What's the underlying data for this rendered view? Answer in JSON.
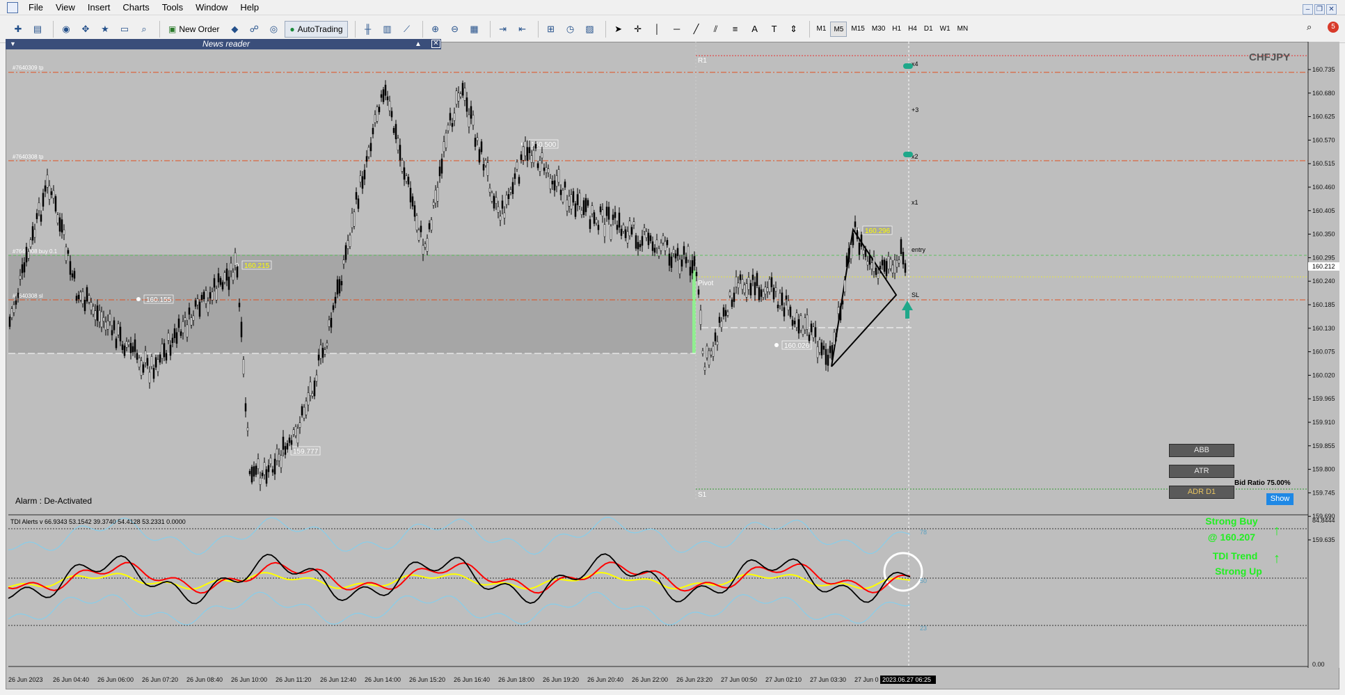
{
  "menu": {
    "items": [
      "File",
      "View",
      "Insert",
      "Charts",
      "Tools",
      "Window",
      "Help"
    ]
  },
  "window_controls": {
    "minimize": "–",
    "restore": "❐",
    "close": "✕"
  },
  "toolbar": {
    "new_order_label": "New Order",
    "autotrading_label": "AutoTrading",
    "timeframes": [
      "M1",
      "M5",
      "M15",
      "M30",
      "H1",
      "H4",
      "D1",
      "W1",
      "MN"
    ],
    "active_timeframe": "M5",
    "notification_count": "5"
  },
  "news_reader": {
    "title": "News reader"
  },
  "chart": {
    "symbol": "CHFJPY",
    "alarm_text": "Alarm : De-Activated",
    "bid_ratio_text": "Bid Ratio 75.00%",
    "show_button": "Show",
    "side_buttons": [
      "ABB",
      "ATR",
      "ADR D1"
    ],
    "price_ticks": [
      "160.735",
      "160.680",
      "160.625",
      "160.570",
      "160.515",
      "160.460",
      "160.405",
      "160.350",
      "160.295",
      "160.240",
      "160.185",
      "160.130",
      "160.075",
      "160.020",
      "159.965",
      "159.910",
      "159.855",
      "159.800",
      "159.745",
      "159.690",
      "159.635"
    ],
    "current_price_tag": "160.212",
    "time_ticks": [
      "26 Jun 2023",
      "26 Jun 04:40",
      "26 Jun 06:00",
      "26 Jun 07:20",
      "26 Jun 08:40",
      "26 Jun 10:00",
      "26 Jun 11:20",
      "26 Jun 12:40",
      "26 Jun 14:00",
      "26 Jun 15:20",
      "26 Jun 16:40",
      "26 Jun 18:00",
      "26 Jun 19:20",
      "26 Jun 20:40",
      "26 Jun 22:00",
      "26 Jun 23:20",
      "27 Jun 00:50",
      "27 Jun 02:10",
      "27 Jun 03:30",
      "27 Jun 0"
    ],
    "crosshair_time": "2023.06.27 06:25",
    "order_labels": [
      "#7640309 tp",
      "#7640308 tp",
      "#7640308 buy 0.1",
      "#7640308 sl"
    ],
    "pivot_labels": [
      "R1",
      "Pivot",
      "S1"
    ],
    "target_labels": [
      "x4",
      "+3",
      "x2",
      "x1",
      "entry",
      "SL"
    ],
    "price_annotations": [
      "160.500",
      "160.215",
      "160.155",
      "159.777",
      "160.296",
      "160.026"
    ],
    "colors": {
      "background": "#bebebe",
      "order_line": "#e05020",
      "buy_line": "#5fc05f",
      "rect_zone": "#a6a6a6",
      "green_bar": "#90ee90",
      "teal_marker": "#1fa88a",
      "annotation_yellow": "#ffff00"
    }
  },
  "indicator": {
    "label": "TDI Alerts v 66.9343 53.1542 39.3740 54.4128 53.2331 0.0000",
    "levels": [
      "78",
      "50",
      "23"
    ],
    "scale_top": "84.8444",
    "scale_bottom": "0.00",
    "signal_buy_line1": "Strong Buy",
    "signal_buy_line2": "@ 160.207",
    "signal_trend_line1": "TDI Trend",
    "signal_trend_line2": "Strong Up",
    "colors": {
      "rsi": "#000000",
      "signal": "#ff0000",
      "market_base": "#ffff00",
      "bands": "#87ceeb",
      "signal_text": "#22ee22"
    }
  }
}
